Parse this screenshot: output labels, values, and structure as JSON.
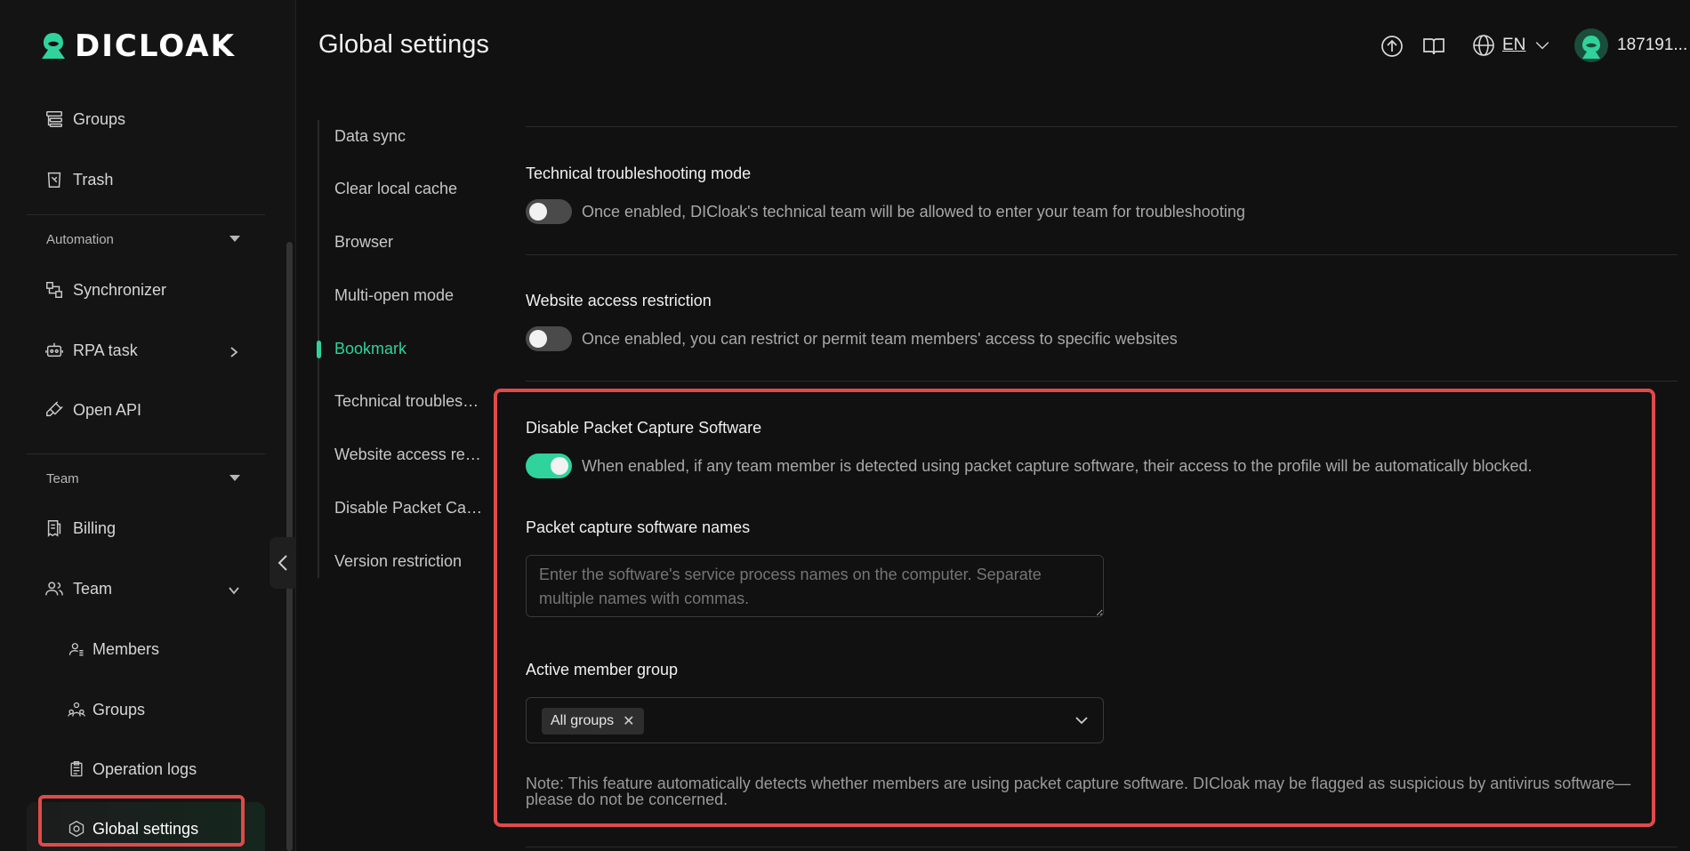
{
  "brand": {
    "name": "DICLOAK"
  },
  "header": {
    "title": "Global settings",
    "language": "EN",
    "user_name": "187191..."
  },
  "sidebar": {
    "items_top": [
      {
        "label": "Groups",
        "icon": "folder-tree-icon"
      },
      {
        "label": "Trash",
        "icon": "trash-icon"
      }
    ],
    "automation": {
      "label": "Automation",
      "items": [
        {
          "label": "Synchronizer",
          "icon": "sync-icon"
        },
        {
          "label": "RPA task",
          "icon": "robot-icon"
        },
        {
          "label": "Open API",
          "icon": "plug-icon"
        }
      ]
    },
    "team": {
      "label": "Team",
      "items": [
        {
          "label": "Billing",
          "icon": "receipt-icon"
        },
        {
          "label": "Team",
          "icon": "users-icon"
        }
      ],
      "sub_items": [
        {
          "label": "Members",
          "icon": "member-icon"
        },
        {
          "label": "Groups",
          "icon": "group-icon"
        },
        {
          "label": "Operation logs",
          "icon": "clipboard-icon"
        },
        {
          "label": "Global settings",
          "icon": "hexagon-gear-icon"
        }
      ]
    }
  },
  "anchors": [
    {
      "label": "Data sync"
    },
    {
      "label": "Clear local cache"
    },
    {
      "label": "Browser"
    },
    {
      "label": "Multi-open mode"
    },
    {
      "label": "Bookmark"
    },
    {
      "label": "Technical troubleshooting mode"
    },
    {
      "label": "Website access restriction"
    },
    {
      "label": "Disable Packet Capture Software"
    },
    {
      "label": "Version restriction"
    }
  ],
  "sections": {
    "technical": {
      "title": "Technical troubleshooting mode",
      "enabled": false,
      "description": "Once enabled, DICloak's technical team will be allowed to enter your team for troubleshooting"
    },
    "website": {
      "title": "Website access restriction",
      "enabled": false,
      "description": "Once enabled, you can restrict or permit team members' access to specific websites"
    },
    "packet": {
      "title": "Disable Packet Capture Software",
      "enabled": true,
      "description": "When enabled, if any team member is detected using packet capture software, their access to the profile will be automatically blocked.",
      "names_label": "Packet capture software names",
      "names_placeholder": "Enter the software's service process names on the computer. Separate multiple names with commas.",
      "group_label": "Active member group",
      "group_tag": "All groups",
      "note": "Note: This feature automatically detects whether members are using packet capture software. DICloak may be flagged as suspicious by antivirus software—please do not be concerned."
    }
  },
  "colors": {
    "accent": "#2fd39b",
    "highlight": "#e04a4a",
    "background": "#111111"
  }
}
